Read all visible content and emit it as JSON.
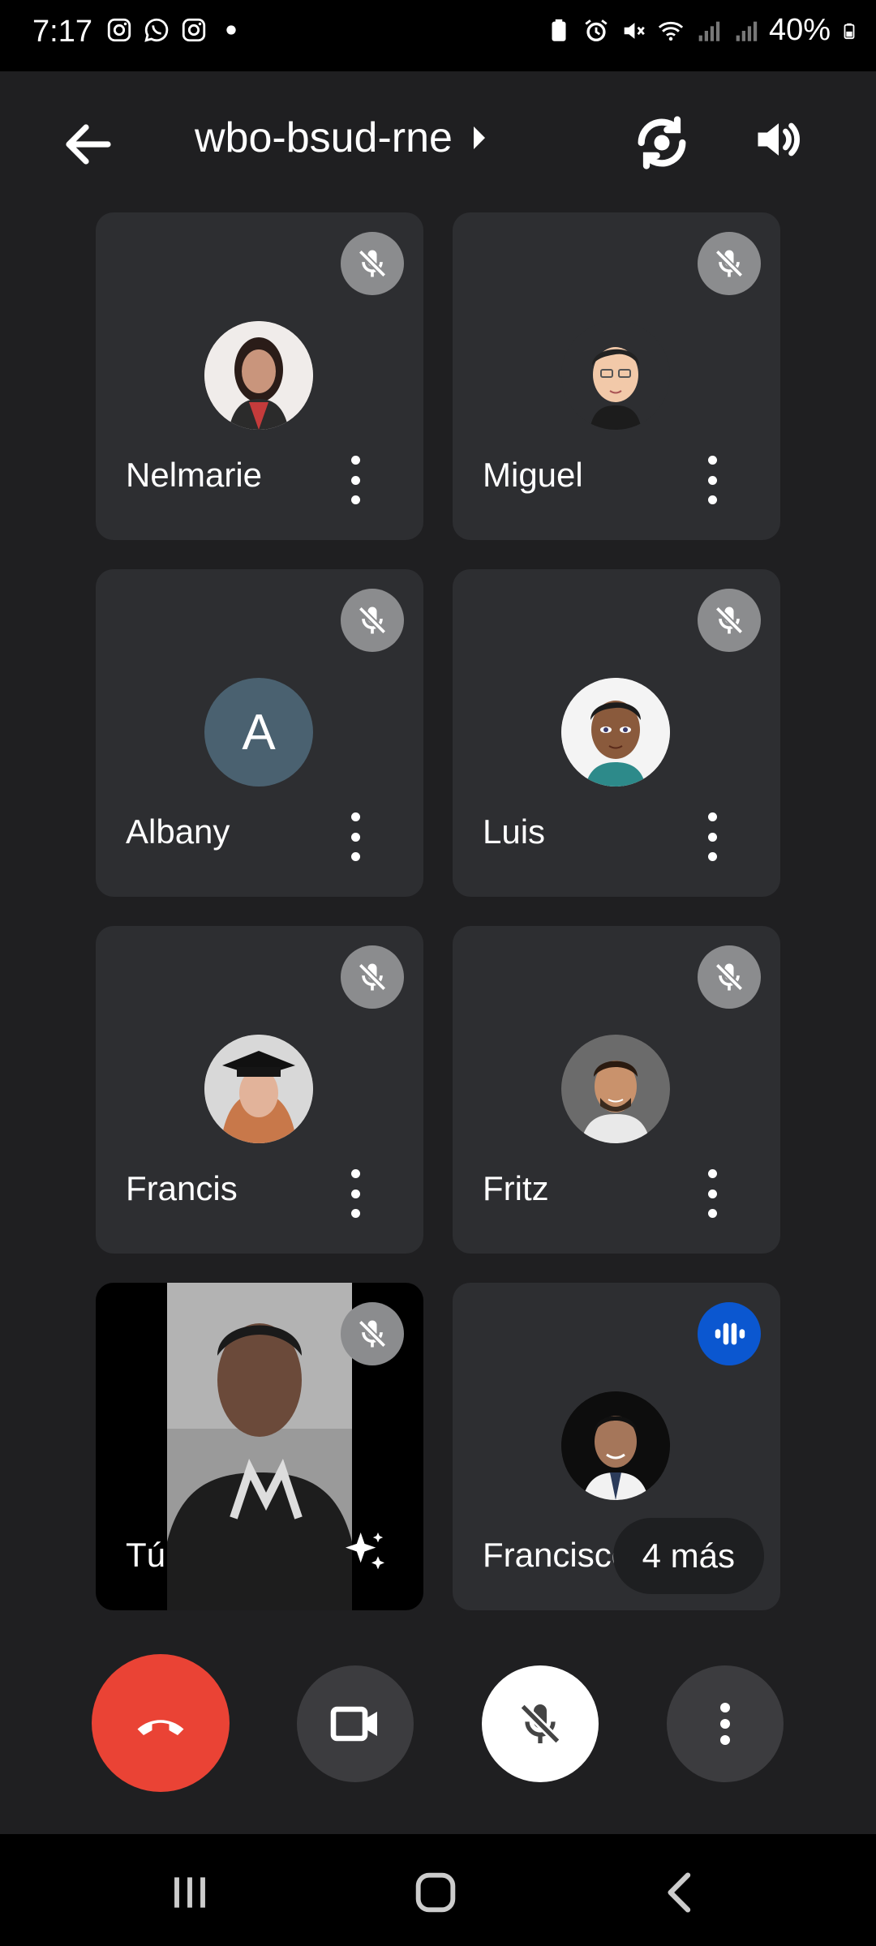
{
  "status_bar": {
    "time": "7:17",
    "left_icons": [
      "instagram-icon",
      "whatsapp-icon",
      "instagram-icon",
      "notification-dot-icon"
    ],
    "right_icons": [
      "battery-saver-icon",
      "alarm-icon",
      "vibrate-mute-icon",
      "wifi-icon",
      "signal-icon",
      "signal-icon"
    ],
    "battery": "40%"
  },
  "header": {
    "meeting_code": "wbo-bsud-rne"
  },
  "participants": [
    {
      "name": "Nelmarie",
      "muted": true,
      "avatar": "photo-avatar"
    },
    {
      "name": "Miguel",
      "muted": true,
      "avatar": "cartoon-avatar"
    },
    {
      "name": "Albany",
      "muted": true,
      "avatar": "letter-avatar",
      "initial": "A"
    },
    {
      "name": "Luis",
      "muted": true,
      "avatar": "cartoon-avatar"
    },
    {
      "name": "Francis",
      "muted": true,
      "avatar": "photo-avatar"
    },
    {
      "name": "Fritz",
      "muted": true,
      "avatar": "photo-avatar"
    },
    {
      "name": "Tú",
      "muted": true,
      "avatar": "self-video"
    },
    {
      "name": "Francisco",
      "muted": false,
      "speaking": true,
      "avatar": "photo-avatar"
    }
  ],
  "more_participants": "4 más",
  "colors": {
    "background": "#1f1f21",
    "tile": "#2d2e31",
    "hangup": "#ea4335",
    "speaking": "#0b57d0"
  }
}
